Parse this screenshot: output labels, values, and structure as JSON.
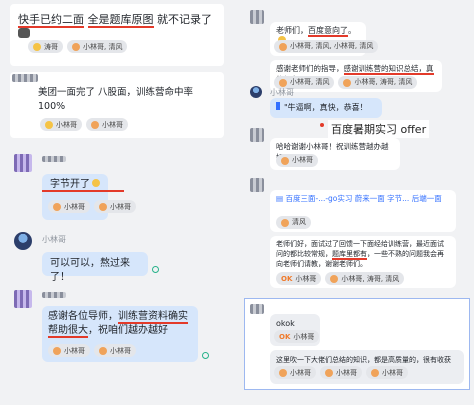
{
  "left": {
    "msg1": {
      "text_a": "快手已约二面",
      "text_b": "全是题库原图",
      "text_c": "就不记录了",
      "reactions": [
        {
          "icon": "sunglasses-emoji-icon",
          "names": "涛哥"
        },
        {
          "icon": "thumbs-up-icon",
          "names": "小林哥, 清风"
        }
      ]
    },
    "msg2": {
      "text": "美团一面完了 八股面，训练营命中率100%",
      "reactions": [
        {
          "icon": "smile-emoji-icon",
          "names": "小林哥"
        },
        {
          "icon": "thumbs-up-icon",
          "names": "小林哥"
        }
      ]
    },
    "msg3": {
      "text": "字节开了",
      "reactions": [
        {
          "icon": "thumbs-up-icon",
          "names": "小林哥"
        },
        {
          "icon": "thumbs-up-icon",
          "names": "小林哥"
        }
      ]
    },
    "msg4": {
      "sender": "小林哥",
      "text": "可以可以，熬过来了！"
    },
    "msg5": {
      "text_a": "感谢各位导师，",
      "text_b": "训练营资料确实帮助很大",
      "text_c": "，祝咱们越办越好",
      "reactions": [
        {
          "icon": "thumbs-up-icon",
          "names": "小林哥"
        },
        {
          "icon": "thumbs-up-icon",
          "names": "小林哥"
        }
      ]
    }
  },
  "right": {
    "msg1": {
      "text_a": "老师们，",
      "text_b": "百度意向了",
      "text_c": "。",
      "reactions": [
        {
          "icon": "thumbs-up-icon",
          "names": "小林哥, 清风, 小林哥, 清风"
        }
      ]
    },
    "msg2": {
      "text_a": "感谢老师们的指导，",
      "text_b": "感谢训练营的知识总结，真的很有用",
      "text_c": "。",
      "reactions": [
        {
          "icon": "thumbs-up-icon",
          "names": "小林哥, 清风"
        },
        {
          "icon": "thumbs-up-icon",
          "names": "小林哥, 涛哥, 清风"
        }
      ]
    },
    "msg3": {
      "sender": "小林哥",
      "text": "\"牛逼啊，真快，恭喜！",
      "overlay": "百度暑期实习 offer"
    },
    "msg4": {
      "text": "哈哈谢谢小林哥！祝训练营越办越好！",
      "reactions": [
        {
          "icon": "thumbs-up-icon",
          "names": "小林哥"
        }
      ]
    },
    "msg5": {
      "links": "百度三面-...-go实习  蔚来一面  字节...  后端一面",
      "reactions": [
        {
          "icon": "thumbs-up-icon",
          "names": "清风"
        }
      ]
    },
    "msg6": {
      "text_a": "老师们好，面试过了回馈一下面经给训练营，最近面试问的都比较常规，",
      "text_b": "题库里都有",
      "text_c": "，一些不熟的问题我会再向老师们请教，谢谢老师们。",
      "reactions": [
        {
          "icon": "ok-icon",
          "names": "小林哥"
        },
        {
          "icon": "thumbs-up-icon",
          "names": "小林哥, 涛哥, 清风"
        }
      ]
    },
    "msg7": {
      "text": "okok",
      "reactions": [
        {
          "icon": "ok-icon",
          "names": "小林哥"
        }
      ]
    },
    "msg8": {
      "text": "这里吹一下大佬们总结的知识，都是高质量的，很有收获",
      "reactions": [
        {
          "icon": "thumbs-up-icon",
          "names": "小林哥"
        },
        {
          "icon": "thumbs-up-icon",
          "names": "小林哥"
        },
        {
          "icon": "thumbs-up-icon",
          "names": "小林哥"
        }
      ]
    }
  },
  "colors": {
    "underline": "#e33a2a",
    "accent_blue": "#3370ff",
    "read_check": "#28b28a"
  }
}
